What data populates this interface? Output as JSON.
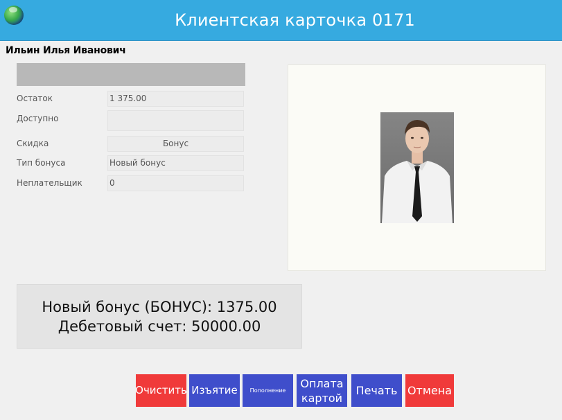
{
  "window": {
    "title": "Клиентская карточка 0171",
    "icon": "globe-app-icon",
    "title_bar_color": "#36aae0"
  },
  "client": {
    "name": "Ильин Илья Иванович"
  },
  "fields": [
    {
      "label": "Остаток",
      "value": "1 375.00"
    },
    {
      "label": "Доступно",
      "value": ""
    },
    {
      "label": "Скидка",
      "value": "Бонус"
    },
    {
      "label": "Тип бонуса",
      "value": "Новый бонус"
    },
    {
      "label": "Неплательщик",
      "value": "0"
    }
  ],
  "photo": {
    "icon": "client-photo"
  },
  "balance": {
    "line1": "Новый бонус (БОНУС): 1375.00",
    "line2": "Дебетовый счет: 50000.00"
  },
  "buttons": {
    "clear": "Очистить",
    "withdraw": "Изъятие",
    "topup": "Пополнение",
    "cardpay_line1": "Оплата",
    "cardpay_line2": "картой",
    "print": "Печать",
    "cancel": "Отмена"
  },
  "colors": {
    "danger": "#f03a3a",
    "primary": "#3f4ecb"
  }
}
